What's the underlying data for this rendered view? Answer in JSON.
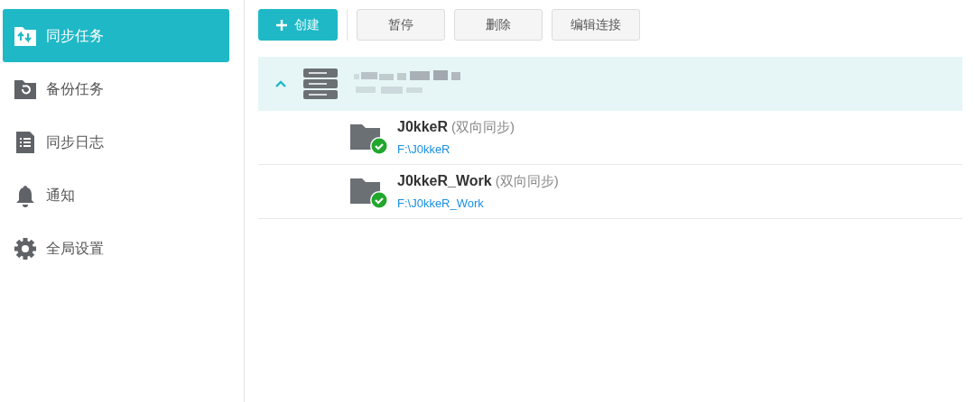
{
  "sidebar": {
    "items": [
      {
        "label": "同步任务",
        "selected": true
      },
      {
        "label": "备份任务",
        "selected": false
      },
      {
        "label": "同步日志",
        "selected": false
      },
      {
        "label": "通知",
        "selected": false
      },
      {
        "label": "全局设置",
        "selected": false
      }
    ]
  },
  "toolbar": {
    "buttons": [
      {
        "label": "创建",
        "kind": "primary"
      },
      {
        "label": "暂停",
        "kind": "plain"
      },
      {
        "label": "删除",
        "kind": "plain"
      },
      {
        "label": "编辑连接",
        "kind": "plain"
      }
    ]
  },
  "connection": {
    "expanded": true,
    "tasks": [
      {
        "name": "J0kkeR",
        "mode": "(双向同步)",
        "path": "F:\\J0kkeR",
        "synced": true
      },
      {
        "name": "J0kkeR_Work",
        "mode": "(双向同步)",
        "path": "F:\\J0kkeR_Work",
        "synced": true
      }
    ]
  }
}
